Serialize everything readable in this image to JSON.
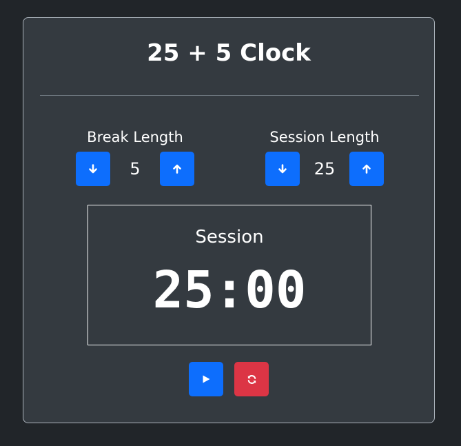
{
  "app": {
    "title": "25 + 5 Clock"
  },
  "break_control": {
    "label": "Break Length",
    "value": "5",
    "decrement_icon": "arrow-down-icon",
    "increment_icon": "arrow-up-icon"
  },
  "session_control": {
    "label": "Session Length",
    "value": "25",
    "decrement_icon": "arrow-down-icon",
    "increment_icon": "arrow-up-icon"
  },
  "timer": {
    "label": "Session",
    "time": "25:00"
  },
  "actions": {
    "play_icon": "play-icon",
    "reset_icon": "refresh-icon"
  },
  "colors": {
    "background": "#212529",
    "card": "#343a40",
    "primary": "#0d6efd",
    "danger": "#dc3545",
    "text": "#ffffff"
  }
}
